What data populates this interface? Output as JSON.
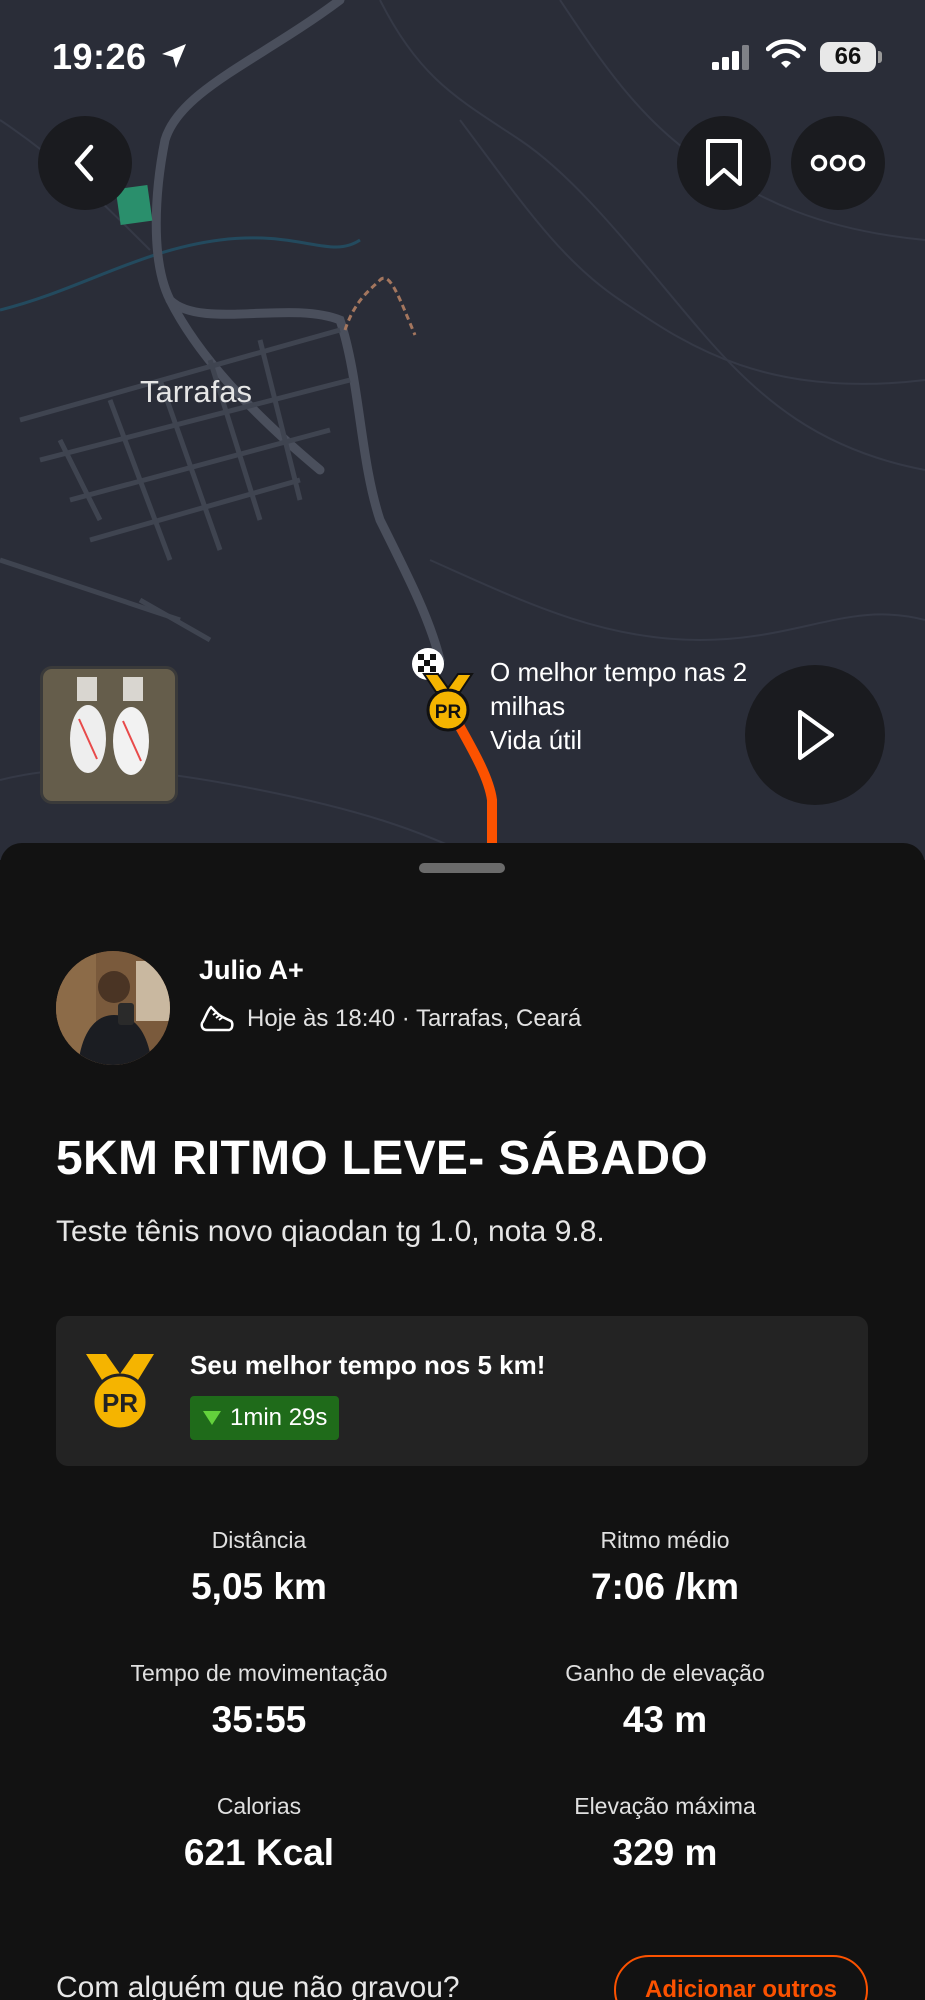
{
  "status_bar": {
    "time": "19:26",
    "battery": "66"
  },
  "map": {
    "town_label": "Tarrafas",
    "pr_label_line1": "O melhor tempo nas 2",
    "pr_label_line2": "milhas",
    "pr_label_line3": "Vida útil",
    "pr_badge_text": "PR"
  },
  "activity": {
    "athlete_name": "Julio A+",
    "meta": "Hoje às 18:40 · Tarrafas, Ceará",
    "title": "5KM RITMO LEVE- SÁBADO",
    "description": "Teste tênis novo qiaodan tg 1.0, nota 9.8."
  },
  "achievement": {
    "medal_text": "PR",
    "text": "Seu melhor tempo nos 5 km!",
    "badge": "1min 29s"
  },
  "stats": [
    {
      "label": "Distância",
      "value": "5,05 km"
    },
    {
      "label": "Ritmo médio",
      "value": "7:06 /km"
    },
    {
      "label": "Tempo de movimentação",
      "value": "35:55"
    },
    {
      "label": "Ganho de elevação",
      "value": "43 m"
    },
    {
      "label": "Calorias",
      "value": "621 Kcal"
    },
    {
      "label": "Elevação máxima",
      "value": "329 m"
    }
  ],
  "footer": {
    "question": "Com alguém que não gravou?",
    "add_button": "Adicionar outros"
  },
  "colors": {
    "accent": "#fc5200",
    "pr_gold": "#f5b400",
    "badge_green": "#1f6b1a"
  }
}
